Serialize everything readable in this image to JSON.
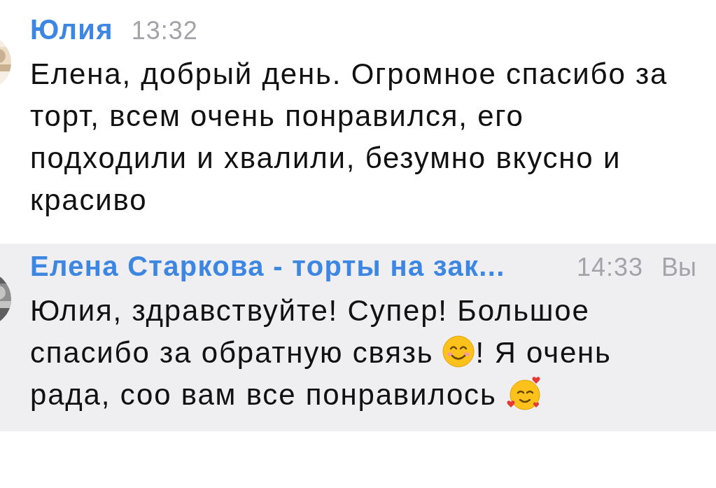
{
  "messages": [
    {
      "author": "Юлия",
      "time": "13:32",
      "highlighted": false,
      "avatar": {
        "kind": "picture"
      },
      "parts": [
        {
          "kind": "text",
          "text": "Елена, добрый день. Огромное спасибо за\nторт, всем очень понравился, его\nподходили и хвалили, безумно вкусно и\nкрасиво"
        }
      ]
    },
    {
      "author": "Елена Старкова - торты на зак...",
      "time": "14:33",
      "sender_label": "Вы",
      "highlighted": true,
      "avatar": {
        "kind": "picture"
      },
      "parts": [
        {
          "kind": "text",
          "text": "Юлия, здравствуйте! Супер! Большое"
        },
        {
          "kind": "break"
        },
        {
          "kind": "text",
          "text": "спасибо за обратную связь"
        },
        {
          "kind": "smile"
        },
        {
          "kind": "text",
          "text": "! Я очень"
        },
        {
          "kind": "break"
        },
        {
          "kind": "text",
          "text": "рада, соо вам все понравилось"
        },
        {
          "kind": "hearts"
        }
      ]
    }
  ]
}
